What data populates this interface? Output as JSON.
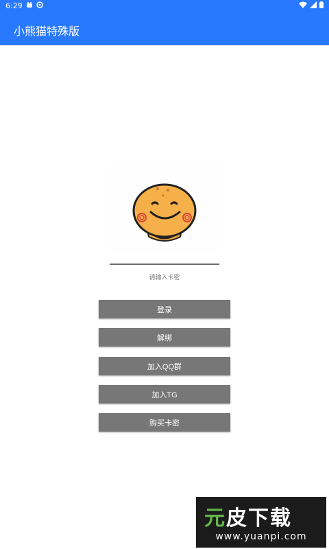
{
  "status_bar": {
    "time": "6:29"
  },
  "app_bar": {
    "title": "小熊猫特殊版"
  },
  "login": {
    "card_placeholder": "请输入卡密"
  },
  "buttons": {
    "login": "登录",
    "unbind": "解绑",
    "join_qq": "加入QQ群",
    "join_tg": "加入TG",
    "buy_card": "购买卡密"
  },
  "watermark": {
    "brand_part1": "元",
    "brand_part2": "皮下载",
    "url": "www.yuanpi.com"
  },
  "colors": {
    "primary": "#2979ff",
    "button": "#777777",
    "watermark_bg": "#1b1b1b",
    "watermark_green": "#63b64a"
  }
}
